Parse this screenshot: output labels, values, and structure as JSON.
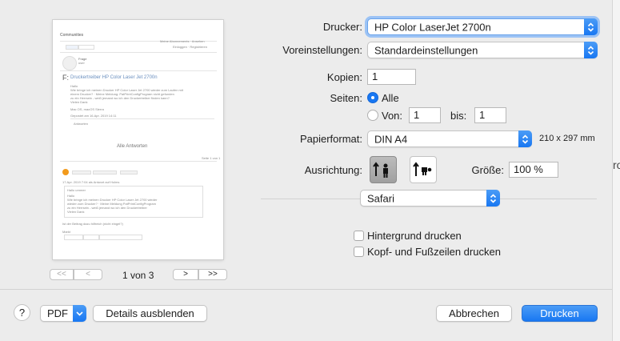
{
  "preview": {
    "site_name": "Communities",
    "post_title": "Druckertreiber HP Color Laser Jet 2700n",
    "all_answers": "Alle Antworten",
    "page_indicator": "1 von 3",
    "nav_first": "<<",
    "nav_prev": "<",
    "nav_next": ">",
    "nav_last": ">>"
  },
  "printer": {
    "label": "Drucker:",
    "value": "HP Color LaserJet 2700n"
  },
  "presets": {
    "label": "Voreinstellungen:",
    "value": "Standardeinstellungen"
  },
  "copies": {
    "label": "Kopien:",
    "value": "1"
  },
  "pages": {
    "label": "Seiten:",
    "all_label": "Alle",
    "from_label": "Von:",
    "from_value": "1",
    "to_label": "bis:",
    "to_value": "1",
    "selected": "all"
  },
  "paper": {
    "label": "Papierformat:",
    "value": "DIN A4",
    "size_text": "210 x 297 mm"
  },
  "orientation": {
    "label": "Ausrichtung:",
    "selected": "portrait"
  },
  "scale": {
    "label": "Größe:",
    "value": "100 %"
  },
  "app_section": {
    "value": "Safari"
  },
  "options": [
    {
      "label": "Hintergrund drucken",
      "checked": false
    },
    {
      "label": "Kopf- und Fußzeilen drucken",
      "checked": false
    }
  ],
  "footer": {
    "help_label": "?",
    "pdf_label": "PDF",
    "details_label": "Details ausblenden",
    "cancel_label": "Abbrechen",
    "print_label": "Drucken"
  },
  "background_window": {
    "partial_text": "ro"
  },
  "colors": {
    "accent": "#1877f2",
    "dialog_bg": "#ececec"
  }
}
